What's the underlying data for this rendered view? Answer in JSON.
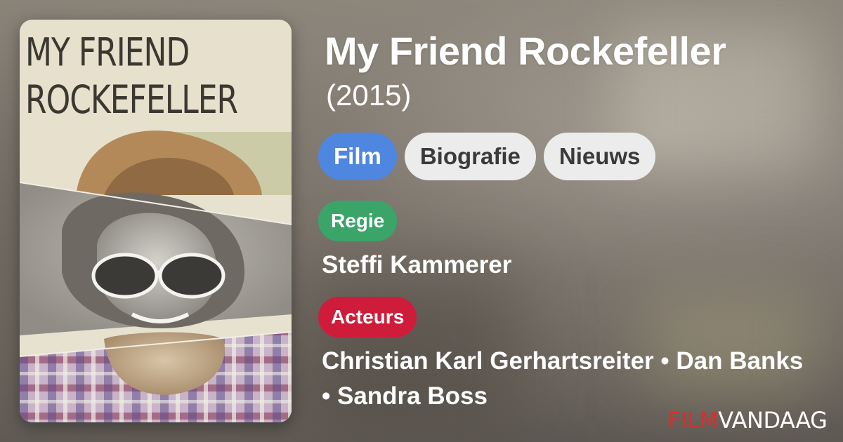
{
  "poster": {
    "title": "MY FRIEND\nROCKEFELLER"
  },
  "movie": {
    "title": "My Friend Rockefeller",
    "year": "(2015)"
  },
  "tabs": [
    {
      "label": "Film",
      "active": true
    },
    {
      "label": "Biografie",
      "active": false
    },
    {
      "label": "Nieuws",
      "active": false
    }
  ],
  "regie": {
    "label": "Regie",
    "names": "Steffi Kammerer"
  },
  "acteurs": {
    "label": "Acteurs",
    "names": "Christian Karl Gerhartsreiter • Dan Banks • Sandra Boss"
  },
  "logo": {
    "part1": "FILM",
    "part2": "VANDAAG"
  },
  "colors": {
    "tab_active": "#4f86e0",
    "regie_badge": "#3ba468",
    "acteurs_badge": "#cf1c3a",
    "logo_red": "#d92e2e"
  }
}
